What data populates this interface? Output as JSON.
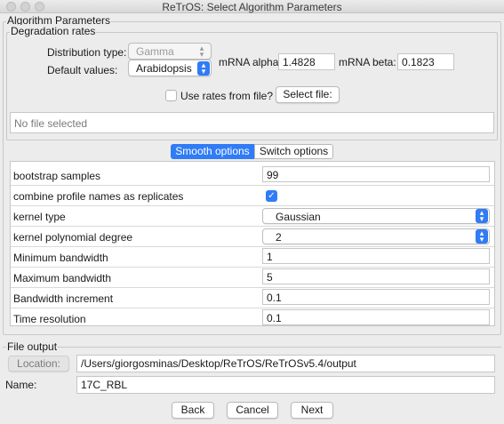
{
  "window": {
    "title": "ReTrOS: Select Algorithm Parameters"
  },
  "algorithm": {
    "group_title": "Algorithm Parameters",
    "degradation": {
      "group_title": "Degradation rates",
      "distribution_label": "Distribution type:",
      "distribution_value": "Gamma",
      "defaults_label": "Default values:",
      "defaults_value": "Arabidopsis",
      "alpha_label": "mRNA alpha:",
      "alpha_value": "1.4828",
      "beta_label": "mRNA beta:",
      "beta_value": "0.1823",
      "use_file_label": "Use rates from file?",
      "use_file_checked": false,
      "select_file_label": "Select file:",
      "file_status": "No file selected"
    },
    "tabs": [
      {
        "label": "Smooth options",
        "active": true
      },
      {
        "label": "Switch options",
        "active": false
      }
    ],
    "smooth_options": [
      {
        "label": "bootstrap samples",
        "kind": "text",
        "value": "99"
      },
      {
        "label": "combine profile names as replicates",
        "kind": "checkbox",
        "checked": true
      },
      {
        "label": "kernel type",
        "kind": "popup",
        "value": "Gaussian"
      },
      {
        "label": "kernel polynomial degree",
        "kind": "popup",
        "value": "2"
      },
      {
        "label": "Minimum bandwidth",
        "kind": "text",
        "value": "1"
      },
      {
        "label": "Maximum bandwidth",
        "kind": "text",
        "value": "5"
      },
      {
        "label": "Bandwidth increment",
        "kind": "text",
        "value": "0.1"
      },
      {
        "label": "Time resolution",
        "kind": "text",
        "value": "0.1"
      }
    ]
  },
  "file_output": {
    "group_title": "File output",
    "location_label": "Location:",
    "location_value": "/Users/giorgosminas/Desktop/ReTrOS/ReTrOSv5.4/output",
    "name_label": "Name:",
    "name_value": "17C_RBL"
  },
  "footer": {
    "back_label": "Back",
    "cancel_label": "Cancel",
    "next_label": "Next"
  },
  "colors": {
    "accent": "#2f7cf6",
    "window_bg": "#ececec"
  },
  "icons": {
    "stepper": "up-down-chevron-icon",
    "check": "checkmark-icon"
  }
}
